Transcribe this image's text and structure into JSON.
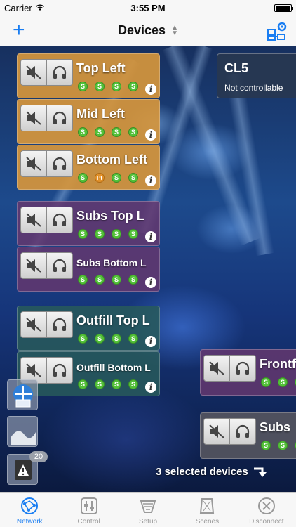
{
  "status_bar": {
    "carrier": "Carrier",
    "time": "3:55 PM"
  },
  "nav": {
    "add_label": "+",
    "title": "Devices"
  },
  "devices": [
    {
      "name": "Top Left",
      "chips": [
        "S",
        "S",
        "S",
        "S"
      ]
    },
    {
      "name": "Mid Left",
      "chips": [
        "S",
        "S",
        "S",
        "S"
      ]
    },
    {
      "name": "Bottom Left",
      "chips": [
        "S",
        "Pt",
        "S",
        "S"
      ]
    },
    {
      "name": "Subs Top L",
      "chips": [
        "S",
        "S",
        "S",
        "S"
      ]
    },
    {
      "name": "Subs Bottom L",
      "chips": [
        "S",
        "S",
        "S",
        "S"
      ]
    },
    {
      "name": "Outfill Top L",
      "chips": [
        "S",
        "S",
        "S",
        "S"
      ]
    },
    {
      "name": "Outfill Bottom L",
      "chips": [
        "S",
        "S",
        "S",
        "S"
      ]
    },
    {
      "name": "Frontf",
      "chips": [
        "S",
        "S",
        "S"
      ]
    },
    {
      "name": "Subs",
      "chips": [
        "S",
        "S",
        "S"
      ]
    }
  ],
  "cl5": {
    "name": "CL5",
    "status": "Not controllable"
  },
  "tools": {
    "badge_count": "20"
  },
  "selection": {
    "text": "3 selected devices"
  },
  "tabs": [
    {
      "label": "Network",
      "icon": "network-icon",
      "active": true
    },
    {
      "label": "Control",
      "icon": "control-icon",
      "active": false
    },
    {
      "label": "Setup",
      "icon": "setup-icon",
      "active": false
    },
    {
      "label": "Scenes",
      "icon": "scenes-icon",
      "active": false
    },
    {
      "label": "Disconnect",
      "icon": "disconnect-icon",
      "active": false
    }
  ],
  "colors": {
    "accent": "#1a7ef2",
    "chip_green": "#53c139",
    "chip_orange": "#e0902a"
  }
}
